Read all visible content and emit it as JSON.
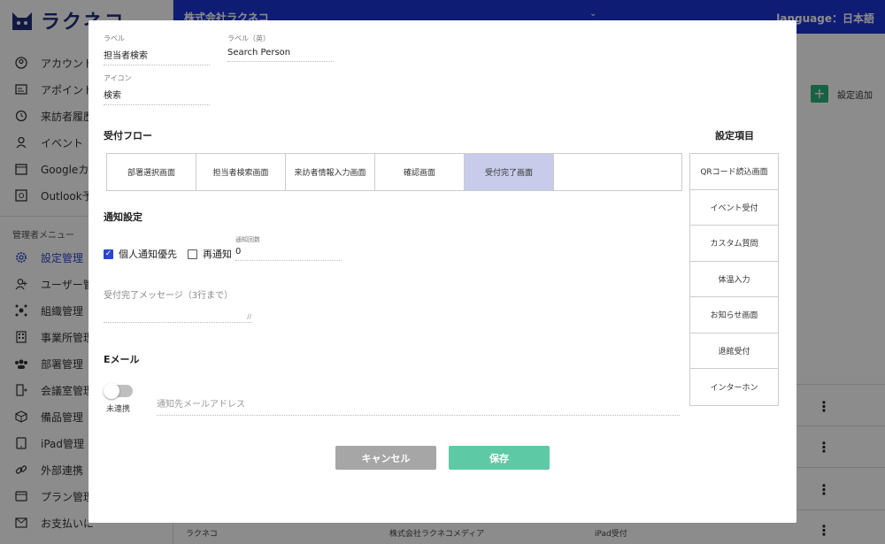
{
  "app": {
    "name": "ラクネコ"
  },
  "header": {
    "company": "株式会社ラクネコ",
    "language": "language：日本語"
  },
  "sidebar": {
    "items": [
      {
        "label": "アカウント",
        "icon": "account-icon"
      },
      {
        "label": "アポイント",
        "icon": "appointment-icon"
      },
      {
        "label": "来訪者履歴",
        "icon": "history-icon"
      },
      {
        "label": "イベント",
        "icon": "person-icon"
      },
      {
        "label": "Googleカレ",
        "icon": "calendar-icon"
      },
      {
        "label": "Outlook予",
        "icon": "outlook-icon"
      }
    ],
    "admin_section": "管理者メニュー",
    "admin_items": [
      {
        "label": "設定管理",
        "icon": "gear-icon",
        "active": true
      },
      {
        "label": "ユーザー管理",
        "icon": "user-add-icon"
      },
      {
        "label": "組織管理",
        "icon": "organization-icon"
      },
      {
        "label": "事業所管理",
        "icon": "building-icon"
      },
      {
        "label": "部署管理",
        "icon": "group-icon"
      },
      {
        "label": "会議室管理",
        "icon": "door-icon"
      },
      {
        "label": "備品管理",
        "icon": "box-icon"
      },
      {
        "label": "iPad管理",
        "icon": "tablet-icon"
      },
      {
        "label": "外部連携",
        "icon": "link-icon"
      },
      {
        "label": "プラン管理",
        "icon": "card-icon"
      },
      {
        "label": "お支払いに",
        "icon": "mail-icon"
      }
    ]
  },
  "main": {
    "add_label": "設定追加",
    "bottom_row": {
      "col1": "ラクネコ",
      "col2": "株式会社ラクネコメディア",
      "col3": "iPad受付"
    }
  },
  "modal": {
    "label_ja": {
      "label": "ラベル",
      "value": "担当者検索"
    },
    "label_en": {
      "label": "ラベル（英）",
      "value": "Search Person"
    },
    "icon_field": {
      "label": "アイコン",
      "value": "検索"
    },
    "flow_title": "受付フロー",
    "flow_steps": [
      "部署選択画面",
      "担当者検索画面",
      "来訪者情報入力画面",
      "確認画面",
      "受付完了画面"
    ],
    "settings_title": "設定項目",
    "settings_items": [
      "QRコード読込画面",
      "イベント受付",
      "カスタム質問",
      "体温入力",
      "お知らせ画面",
      "退館受付",
      "インターホン"
    ],
    "notify_title": "通知設定",
    "notify_personal": "個人通知優先",
    "notify_repeat": "再通知",
    "notify_count_label": "通知回数",
    "notify_count_value": "0",
    "complete_message_placeholder": "受付完了メッセージ（3行まで）",
    "email_title": "Eメール",
    "email_toggle_label": "未連携",
    "email_placeholder": "通知先メールアドレス",
    "cancel_label": "キャンセル",
    "save_label": "保存"
  },
  "colors": {
    "primary": "#1c34d4",
    "active_step": "#c8cbea",
    "save": "#5ecaa5",
    "cancel": "#a6a6a6",
    "add": "#2db37a"
  }
}
